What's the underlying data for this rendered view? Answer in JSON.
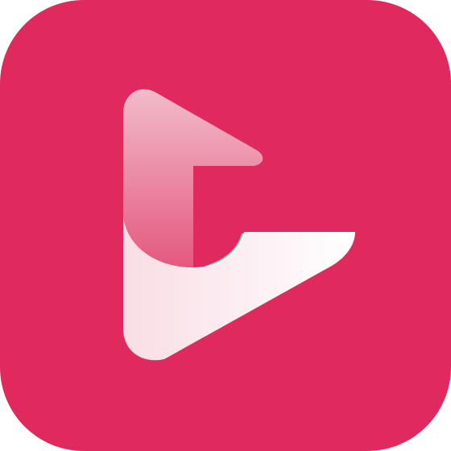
{
  "icon": {
    "name": "play-logo-app-icon",
    "glyph": "play-logo-icon",
    "colors": {
      "background": "#E02A5E",
      "shape_light": "#FFFFFF",
      "shape_mid": "#F9DDE5",
      "shape_pink_top": "#F2BCCB",
      "shape_pink_bottom": "#E4587E",
      "accent_teal": "#4FE3C6"
    }
  }
}
